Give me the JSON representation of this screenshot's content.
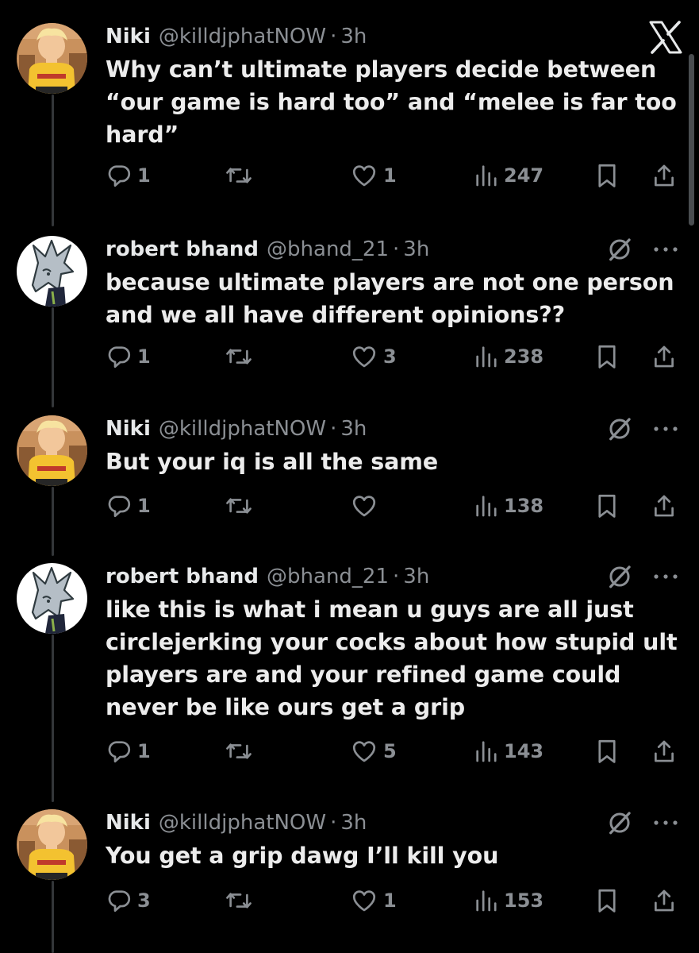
{
  "app": {
    "logo_icon": "x-logo-icon"
  },
  "tweets": [
    {
      "name": "Niki",
      "handle": "@killdjphatNOW",
      "separator": "·",
      "time": "3h",
      "avatar_icon": "niki-avatar",
      "show_mute": false,
      "text_lines": [
        "Why can’t ultimate players decide between",
        "“our game is hard too” and “melee is far too",
        "hard”"
      ],
      "replies": "1",
      "retweets": "",
      "likes": "1",
      "views": "247"
    },
    {
      "name": "robert bhand",
      "handle": "@bhand_21",
      "separator": "·",
      "time": "3h",
      "avatar_icon": "robert-avatar",
      "show_mute": true,
      "text_lines": [
        "because ultimate players are not one person",
        "and we all have different opinions??"
      ],
      "replies": "1",
      "retweets": "",
      "likes": "3",
      "views": "238"
    },
    {
      "name": "Niki",
      "handle": "@killdjphatNOW",
      "separator": "·",
      "time": "3h",
      "avatar_icon": "niki-avatar",
      "show_mute": true,
      "text_lines": [
        "But your iq is all the same"
      ],
      "replies": "1",
      "retweets": "",
      "likes": "",
      "views": "138"
    },
    {
      "name": "robert bhand",
      "handle": "@bhand_21",
      "separator": "·",
      "time": "3h",
      "avatar_icon": "robert-avatar",
      "show_mute": true,
      "text_lines": [
        "like this is what i mean u guys are all just",
        "circlejerking your cocks about how stupid ult",
        "players are and your refined game could",
        "never be like ours get a grip"
      ],
      "replies": "1",
      "retweets": "",
      "likes": "5",
      "views": "143"
    },
    {
      "name": "Niki",
      "handle": "@killdjphatNOW",
      "separator": "·",
      "time": "3h",
      "avatar_icon": "niki-avatar",
      "show_mute": true,
      "text_lines": [
        "You get a grip dawg I’ll kill you"
      ],
      "replies": "3",
      "retweets": "",
      "likes": "1",
      "views": "153"
    }
  ],
  "icons": {
    "reply": "reply-icon",
    "retweet": "retweet-icon",
    "like": "heart-icon",
    "views": "views-icon",
    "bookmark": "bookmark-icon",
    "share": "share-icon",
    "mute": "mute-icon",
    "more": "more-icon"
  },
  "colors": {
    "background": "#000000",
    "text": "#e7e9ea",
    "secondary": "#8b8f94",
    "thread_line": "#333639"
  }
}
